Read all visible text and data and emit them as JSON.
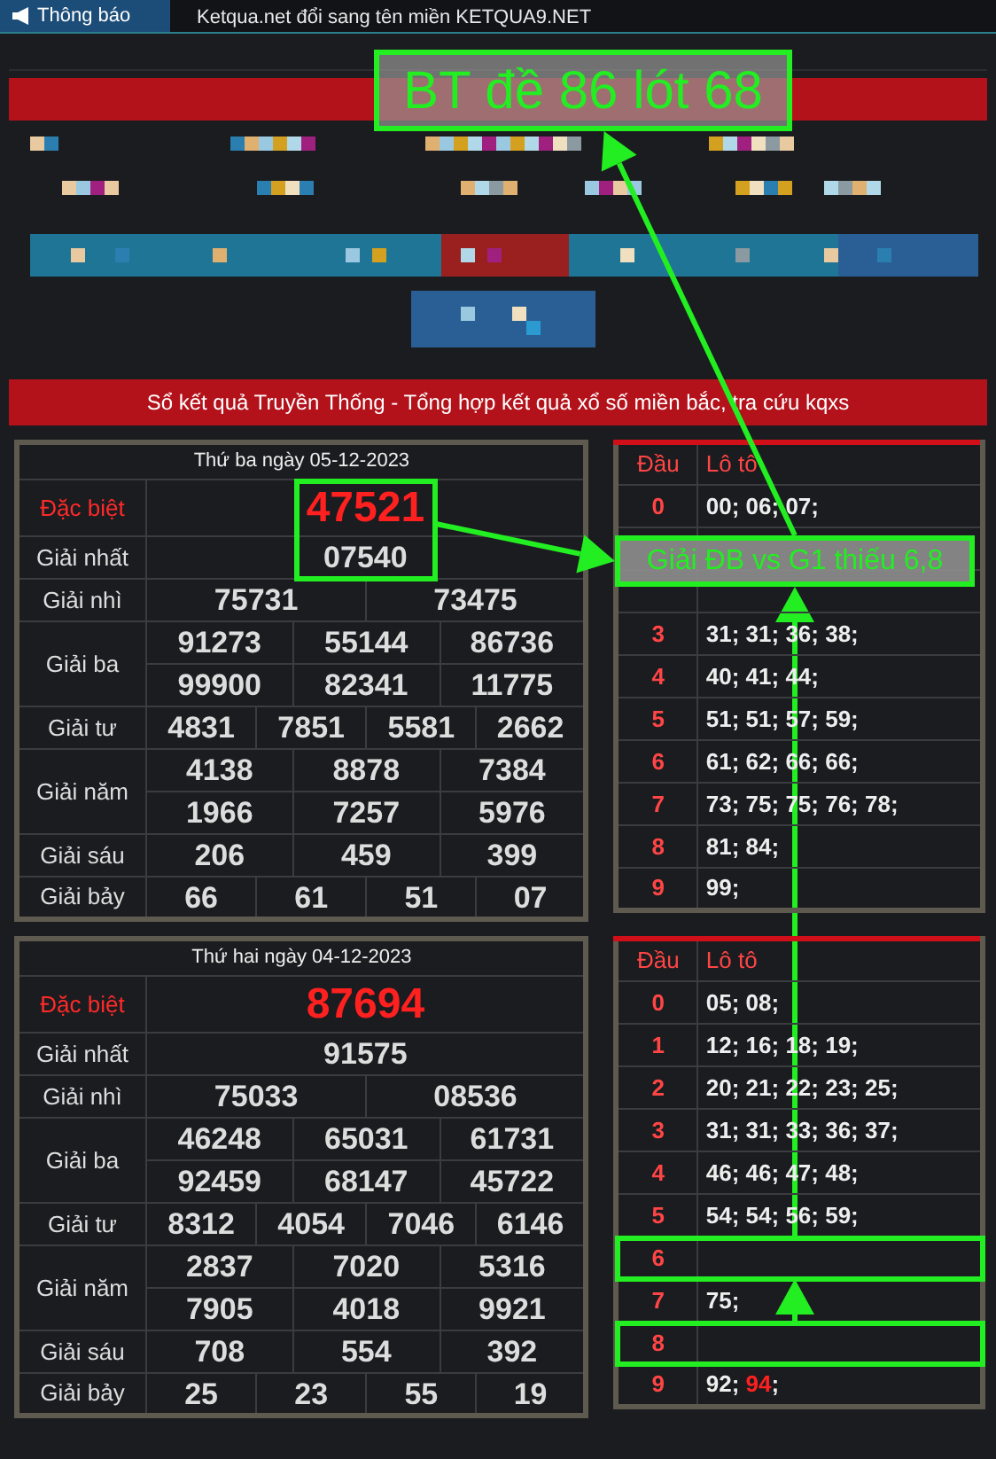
{
  "notice_bar": {
    "tab": "Thông báo",
    "message": "Ketqua.net đổi sang tên miền KETQUA9.NET"
  },
  "section_title": "Sổ kết quả Truyền Thống - Tổng hợp kết quả xổ số miền bắc, tra cứu kqxs",
  "results": [
    {
      "date": "Thứ ba ngày 05-12-2023",
      "prizes": [
        {
          "name": "Đặc biệt",
          "kind": "special",
          "rows": [
            [
              "47521"
            ]
          ],
          "boxed": true
        },
        {
          "name": "Giải nhất",
          "kind": "normal",
          "rows": [
            [
              "07540"
            ]
          ],
          "boxed": true
        },
        {
          "name": "Giải nhì",
          "kind": "normal",
          "rows": [
            [
              "75731",
              "73475"
            ]
          ],
          "boxed": false
        },
        {
          "name": "Giải ba",
          "kind": "normal",
          "rows": [
            [
              "91273",
              "55144",
              "86736"
            ],
            [
              "99900",
              "82341",
              "11775"
            ]
          ],
          "boxed": false
        },
        {
          "name": "Giải tư",
          "kind": "normal",
          "rows": [
            [
              "4831",
              "7851",
              "5581",
              "2662"
            ]
          ],
          "boxed": false
        },
        {
          "name": "Giải năm",
          "kind": "normal",
          "rows": [
            [
              "4138",
              "8878",
              "7384"
            ],
            [
              "1966",
              "7257",
              "5976"
            ]
          ],
          "boxed": false
        },
        {
          "name": "Giải sáu",
          "kind": "normal",
          "rows": [
            [
              "206",
              "459",
              "399"
            ]
          ],
          "boxed": false
        },
        {
          "name": "Giải bảy",
          "kind": "normal",
          "rows": [
            [
              "66",
              "61",
              "51",
              "07"
            ]
          ],
          "boxed": false
        }
      ],
      "loto": {
        "head_label": "Đầu",
        "tail_label": "Lô tô",
        "rows": [
          {
            "head": "0",
            "values": [
              {
                "text": "00; 06; 07;",
                "highlight": false
              }
            ],
            "boxed": false
          },
          {
            "values": [],
            "boxed": false
          },
          {
            "values": [],
            "boxed": false
          },
          {
            "head": "3",
            "values": [
              {
                "text": "31; 31; 36; 38;",
                "highlight": false
              }
            ],
            "boxed": false
          },
          {
            "head": "4",
            "values": [
              {
                "text": "40; 41; 44;",
                "highlight": false
              }
            ],
            "boxed": false
          },
          {
            "head": "5",
            "values": [
              {
                "text": "51; 51; 57; 59;",
                "highlight": false
              }
            ],
            "boxed": false
          },
          {
            "head": "6",
            "values": [
              {
                "text": "61; 62; 66; 66;",
                "highlight": false
              }
            ],
            "boxed": false
          },
          {
            "head": "7",
            "values": [
              {
                "text": "73; 75; 75; 76; 78;",
                "highlight": false
              }
            ],
            "boxed": false
          },
          {
            "head": "8",
            "values": [
              {
                "text": "81; 84;",
                "highlight": false
              }
            ],
            "boxed": false
          },
          {
            "head": "9",
            "values": [
              {
                "text": "99;",
                "highlight": false
              }
            ],
            "boxed": false
          }
        ]
      }
    },
    {
      "date": "Thứ hai ngày 04-12-2023",
      "prizes": [
        {
          "name": "Đặc biệt",
          "kind": "special",
          "rows": [
            [
              "87694"
            ]
          ],
          "boxed": false
        },
        {
          "name": "Giải nhất",
          "kind": "normal",
          "rows": [
            [
              "91575"
            ]
          ],
          "boxed": false
        },
        {
          "name": "Giải nhì",
          "kind": "normal",
          "rows": [
            [
              "75033",
              "08536"
            ]
          ],
          "boxed": false
        },
        {
          "name": "Giải ba",
          "kind": "normal",
          "rows": [
            [
              "46248",
              "65031",
              "61731"
            ],
            [
              "92459",
              "68147",
              "45722"
            ]
          ],
          "boxed": false
        },
        {
          "name": "Giải tư",
          "kind": "normal",
          "rows": [
            [
              "8312",
              "4054",
              "7046",
              "6146"
            ]
          ],
          "boxed": false
        },
        {
          "name": "Giải năm",
          "kind": "normal",
          "rows": [
            [
              "2837",
              "7020",
              "5316"
            ],
            [
              "7905",
              "4018",
              "9921"
            ]
          ],
          "boxed": false
        },
        {
          "name": "Giải sáu",
          "kind": "normal",
          "rows": [
            [
              "708",
              "554",
              "392"
            ]
          ],
          "boxed": false
        },
        {
          "name": "Giải bảy",
          "kind": "normal",
          "rows": [
            [
              "25",
              "23",
              "55",
              "19"
            ]
          ],
          "boxed": false
        }
      ],
      "loto": {
        "head_label": "Đầu",
        "tail_label": "Lô tô",
        "rows": [
          {
            "head": "0",
            "values": [
              {
                "text": "05; 08;",
                "highlight": false
              }
            ],
            "boxed": false
          },
          {
            "head": "1",
            "values": [
              {
                "text": "12; 16; 18; 19;",
                "highlight": false
              }
            ],
            "boxed": false
          },
          {
            "head": "2",
            "values": [
              {
                "text": "20; 21; 22; 23; 25;",
                "highlight": false
              }
            ],
            "boxed": false
          },
          {
            "head": "3",
            "values": [
              {
                "text": "31; 31; 33; 36; 37;",
                "highlight": false
              }
            ],
            "boxed": false
          },
          {
            "head": "4",
            "values": [
              {
                "text": "46; 46; 47; 48;",
                "highlight": false
              }
            ],
            "boxed": false
          },
          {
            "head": "5",
            "values": [
              {
                "text": "54; 54; 56; 59;",
                "highlight": false
              }
            ],
            "boxed": false
          },
          {
            "head": "6",
            "values": [],
            "boxed": true
          },
          {
            "head": "7",
            "values": [
              {
                "text": "75;",
                "highlight": false
              }
            ],
            "boxed": false
          },
          {
            "head": "8",
            "values": [],
            "boxed": true
          },
          {
            "head": "9",
            "values": [
              {
                "text": "92; ",
                "highlight": false
              },
              {
                "text": "94",
                "highlight": true
              },
              {
                "text": ";",
                "highlight": false
              }
            ],
            "boxed": false
          }
        ]
      }
    }
  ],
  "annotations": [
    {
      "kind": "banner_note",
      "text": "BT đề 86 lót 68"
    },
    {
      "kind": "loto_note",
      "text": "Giải ĐB vs G1 thiếu 6,8"
    }
  ]
}
